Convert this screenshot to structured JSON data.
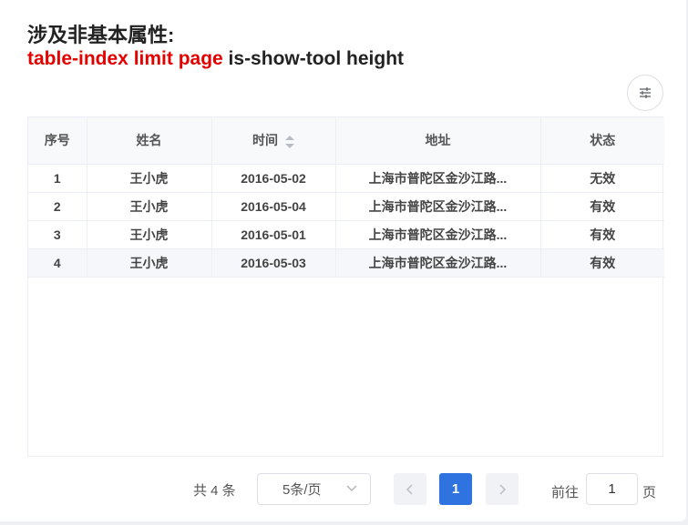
{
  "heading": {
    "line1": "涉及非基本属性:",
    "line2_red": "table-index limit page",
    "line2_rest": " is-show-tool height"
  },
  "toolbar": {
    "settings_icon": "sliders-icon"
  },
  "table": {
    "columns": [
      "序号",
      "姓名",
      "时间",
      "地址",
      "状态"
    ],
    "rows": [
      [
        "1",
        "王小虎",
        "2016-05-02",
        "上海市普陀区金沙江路...",
        "无效"
      ],
      [
        "2",
        "王小虎",
        "2016-05-04",
        "上海市普陀区金沙江路...",
        "有效"
      ],
      [
        "3",
        "王小虎",
        "2016-05-01",
        "上海市普陀区金沙江路...",
        "有效"
      ],
      [
        "4",
        "王小虎",
        "2016-05-03",
        "上海市普陀区金沙江路...",
        "有效"
      ]
    ]
  },
  "pagination": {
    "total": "共 4 条",
    "page_size": "5条/页",
    "current_page": "1",
    "goto_prefix": "前往",
    "goto_value": "1",
    "goto_suffix": "页"
  },
  "colors": {
    "accent": "#2f73e0",
    "highlight": "#e50000"
  }
}
